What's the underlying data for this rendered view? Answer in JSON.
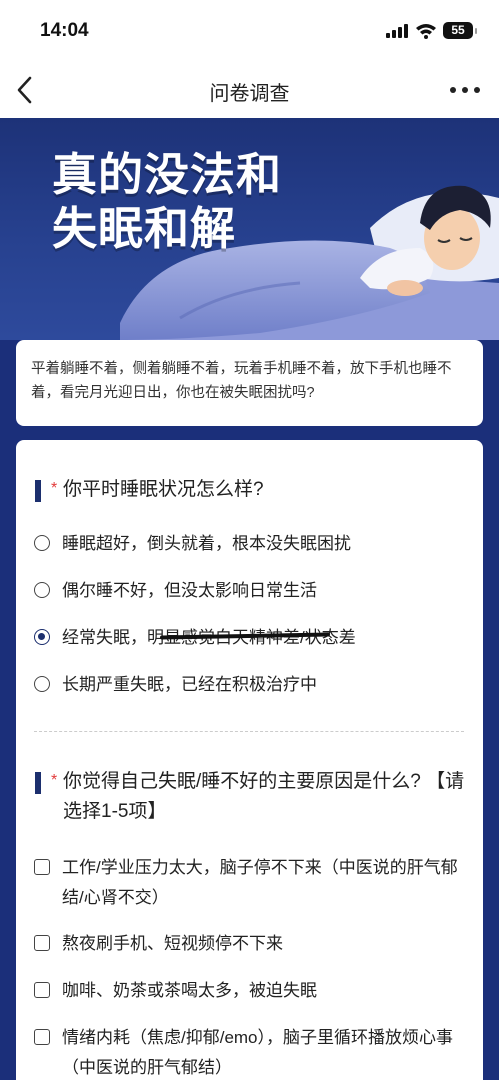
{
  "status_bar": {
    "time": "14:04",
    "battery": "55"
  },
  "nav": {
    "title": "问卷调查"
  },
  "banner": {
    "headline_line1": "真的没法和",
    "headline_line2": "失眠和解"
  },
  "intro": {
    "text": "平着躺睡不着，侧着躺睡不着，玩着手机睡不着，放下手机也睡不着，看完月光迎日出，你也在被失眠困扰吗?"
  },
  "questions": [
    {
      "required_mark": "*",
      "title": "你平时睡眠状况怎么样?",
      "type": "radio",
      "options": [
        {
          "label": "睡眠超好，倒头就着，根本没失眠困扰",
          "selected": false
        },
        {
          "label": "偶尔睡不好，但没太影响日常生活",
          "selected": false
        },
        {
          "label": "经常失眠，明显感觉白天精神差/状态差",
          "selected": true
        },
        {
          "label": "长期严重失眠，已经在积极治疗中",
          "selected": false
        }
      ]
    },
    {
      "required_mark": "*",
      "title": "你觉得自己失眠/睡不好的主要原因是什么? 【请选择1-5项】",
      "type": "checkbox",
      "options": [
        {
          "label": "工作/学业压力太大，脑子停不下来（中医说的肝气郁结/心肾不交）"
        },
        {
          "label": "熬夜刷手机、短视频停不下来"
        },
        {
          "label": "咖啡、奶茶或茶喝太多，被迫失眠"
        },
        {
          "label": "情绪内耗（焦虑/抑郁/emo），脑子里循环播放烦心事（中医说的肝气郁结）"
        }
      ]
    }
  ]
}
